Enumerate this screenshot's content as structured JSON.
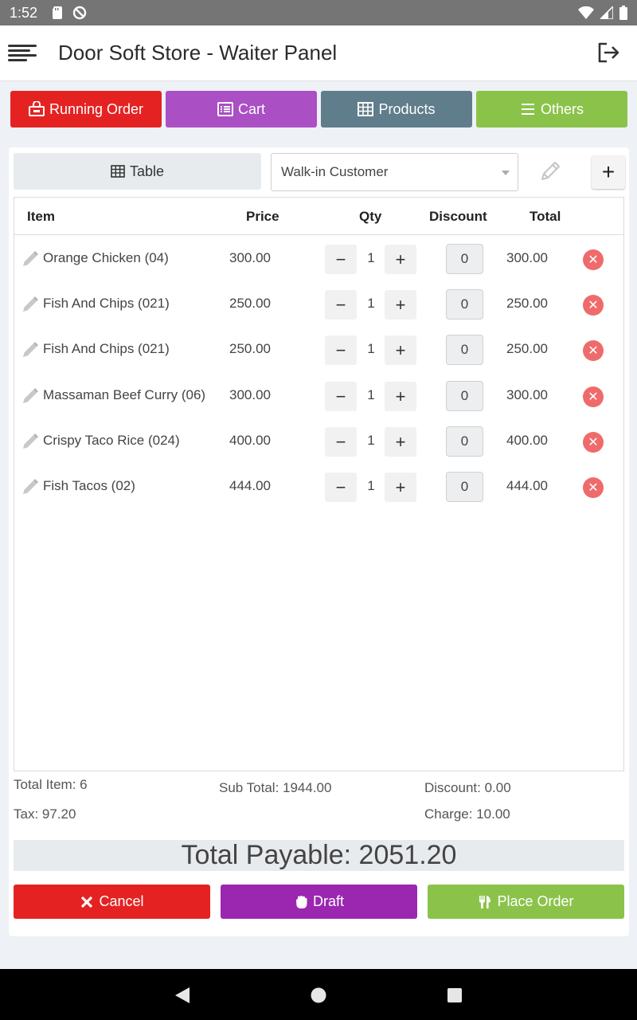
{
  "status_bar": {
    "time": "1:52"
  },
  "app_bar": {
    "title": "Door Soft Store - Waiter Panel"
  },
  "nav_buttons": [
    {
      "label": "Running Order",
      "color": "#e52222",
      "icon": "cart-bag-icon"
    },
    {
      "label": "Cart",
      "color": "#ab4fc4",
      "icon": "list-icon"
    },
    {
      "label": "Products",
      "color": "#607d8b",
      "icon": "grid-icon"
    },
    {
      "label": "Others",
      "color": "#8bc34a",
      "icon": "menu-lines-icon"
    }
  ],
  "table_button": {
    "label": "Table"
  },
  "customer": {
    "selected": "Walk-in Customer"
  },
  "table_headers": {
    "item": "Item",
    "price": "Price",
    "qty": "Qty",
    "discount": "Discount",
    "total": "Total"
  },
  "items": [
    {
      "name": "Orange Chicken (04)",
      "price": "300.00",
      "qty": "1",
      "discount": "0",
      "total": "300.00"
    },
    {
      "name": "Fish And Chips (021)",
      "price": "250.00",
      "qty": "1",
      "discount": "0",
      "total": "250.00"
    },
    {
      "name": "Fish And Chips (021)",
      "price": "250.00",
      "qty": "1",
      "discount": "0",
      "total": "250.00"
    },
    {
      "name": "Massaman Beef Curry (06)",
      "price": "300.00",
      "qty": "1",
      "discount": "0",
      "total": "300.00"
    },
    {
      "name": "Crispy Taco Rice (024)",
      "price": "400.00",
      "qty": "1",
      "discount": "0",
      "total": "400.00"
    },
    {
      "name": "Fish Tacos (02)",
      "price": "444.00",
      "qty": "1",
      "discount": "0",
      "total": "444.00"
    }
  ],
  "summary": {
    "total_item": "Total Item: 6",
    "sub_total": "Sub Total: 1944.00",
    "discount": "Discount: 0.00",
    "tax": "Tax: 97.20",
    "charge": "Charge: 10.00"
  },
  "total_payable": "Total Payable: 2051.20",
  "actions": {
    "cancel": "Cancel",
    "draft": "Draft",
    "place_order": "Place Order"
  },
  "colors": {
    "cancel": "#e52222",
    "draft": "#9b27b0",
    "place_order": "#8bc34a"
  }
}
